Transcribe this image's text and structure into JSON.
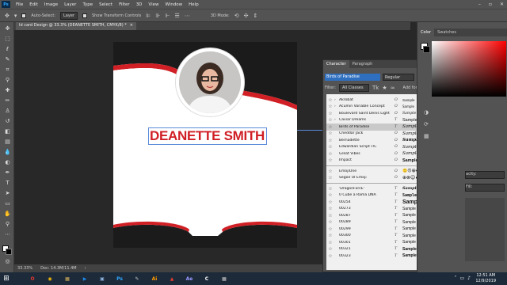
{
  "menubar": {
    "logo": "Ps",
    "items": [
      "File",
      "Edit",
      "Image",
      "Layer",
      "Type",
      "Select",
      "Filter",
      "3D",
      "View",
      "Window",
      "Help"
    ]
  },
  "optbar": {
    "auto_select_label": "Auto-Select:",
    "auto_select_value": "Layer",
    "transform_label": "Show Transform Controls",
    "mode_label": "3D Mode:"
  },
  "document": {
    "tab_title": "Id card Design @ 33.3% (DEANETTE SMITH, CMYK/8) *",
    "tab_close": "×",
    "name_text": "DEANETTE SMITH"
  },
  "status": {
    "zoom": "33.33%",
    "doc": "Doc: 14.3M/11.4M"
  },
  "character_panel": {
    "tabs": [
      "Character",
      "Paragraph"
    ],
    "font_name": "Birds of Paradise",
    "font_style": "Regular",
    "filter_label": "Filter:",
    "filter_value": "All Classes",
    "add_fonts_label": "Add fonts from Typekit:",
    "fonts": [
      {
        "name": "Akrobat",
        "sample": "Sample",
        "has_arrow": true,
        "type": "O"
      },
      {
        "name": "Acumin Variable Concept",
        "sample": "Sample",
        "has_arrow": true,
        "type": "O"
      },
      {
        "name": "Boulevard Saint Denis Light",
        "sample": "Sample",
        "has_arrow": false,
        "type": "O"
      },
      {
        "name": "Caviar Dreams",
        "sample": "Sample",
        "has_arrow": true,
        "type": "T"
      },
      {
        "name": "Birds of Paradise",
        "sample": "Sample",
        "has_arrow": false,
        "type": "T"
      },
      {
        "name": "Cheddar Jack",
        "sample": "Sample",
        "has_arrow": false,
        "type": "O"
      },
      {
        "name": "Bernadette",
        "sample": "Sample",
        "has_arrow": false,
        "type": "O"
      },
      {
        "name": "Edwardian Script ITC",
        "sample": "Sample",
        "has_arrow": false,
        "type": "O"
      },
      {
        "name": "Great Vibes",
        "sample": "Sample",
        "has_arrow": false,
        "type": "O"
      },
      {
        "name": "Impact",
        "sample": "Sample",
        "has_arrow": false,
        "type": "O"
      }
    ],
    "emoji_fonts": [
      {
        "name": "EmojiOne",
        "sample": "🙂🙃😀♻",
        "type": "O"
      },
      {
        "name": "Segoe UI Emoji",
        "sample": "⊕⊗☺♣⚽",
        "type": "O"
      }
    ],
    "more_fonts": [
      {
        "name": "'DragonForcE'",
        "sample": "Sample",
        "type": "T"
      },
      {
        "name": "0 Cube a Rama DNA",
        "sample": "Sample",
        "type": "T"
      },
      {
        "name": "00254",
        "sample": "Sample",
        "type": "T"
      },
      {
        "name": "00273",
        "sample": "Sample",
        "type": "T"
      },
      {
        "name": "00287",
        "sample": "Sample",
        "type": "T"
      },
      {
        "name": "00289",
        "sample": "Sample",
        "type": "T"
      },
      {
        "name": "00299",
        "sample": "Sample",
        "type": "T"
      },
      {
        "name": "00300",
        "sample": "Sample",
        "type": "T"
      },
      {
        "name": "00301",
        "sample": "Sample",
        "type": "T"
      },
      {
        "name": "00321",
        "sample": "Sample",
        "type": "T"
      },
      {
        "name": "00323",
        "sample": "Sample",
        "type": "T"
      }
    ]
  },
  "right_dock": {
    "tabs": [
      "Color",
      "Swatches"
    ],
    "opacity_label": "acity:",
    "fill_label": "Fill:"
  },
  "taskbar": {
    "apps": [
      {
        "label": "O",
        "color": "#e03a2f",
        "name": "opera"
      },
      {
        "label": "◉",
        "color": "#fbbc05",
        "name": "chrome"
      },
      {
        "label": "▦",
        "color": "#d8b25a",
        "name": "file-explorer"
      },
      {
        "label": "▶",
        "color": "#1e88e5",
        "name": "media"
      },
      {
        "label": "▣",
        "color": "#8fb4e0",
        "name": "gallery"
      },
      {
        "label": "Ps",
        "color": "#31a8ff",
        "name": "photoshop"
      },
      {
        "label": "✎",
        "color": "#cccccc",
        "name": "notepad"
      },
      {
        "label": "Ai",
        "color": "#ff9a00",
        "name": "illustrator"
      },
      {
        "label": "▲",
        "color": "#e03a2f",
        "name": "app-red"
      },
      {
        "label": "Ae",
        "color": "#9999ff",
        "name": "after-effects"
      },
      {
        "label": "C",
        "color": "#ffffff",
        "name": "app-c"
      },
      {
        "label": "▦",
        "color": "#cccccc",
        "name": "app-grid"
      }
    ],
    "time": "12:51 AM",
    "date": "12/9/2019"
  },
  "colors": {
    "accent_red": "#d01f25",
    "dark": "#1b1b1b"
  }
}
